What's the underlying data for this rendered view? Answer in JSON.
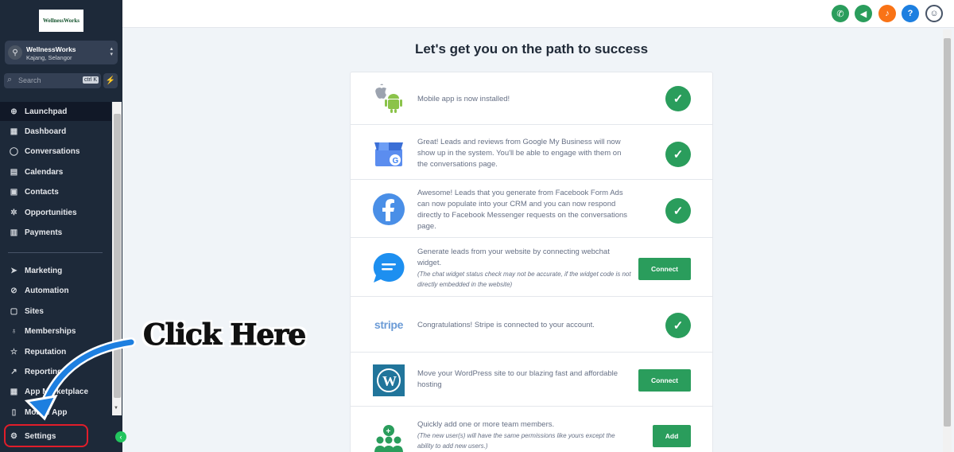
{
  "sidebar": {
    "logo_text": "WellnessWorks",
    "account": {
      "name": "WellnessWorks",
      "location": "Kajang, Selangor"
    },
    "search": {
      "placeholder": "Search",
      "shortcut": "ctrl K"
    },
    "items_top": [
      {
        "label": "Launchpad",
        "icon": "rocket-icon",
        "active": true
      },
      {
        "label": "Dashboard",
        "icon": "grid-icon"
      },
      {
        "label": "Conversations",
        "icon": "chat-icon"
      },
      {
        "label": "Calendars",
        "icon": "calendar-icon"
      },
      {
        "label": "Contacts",
        "icon": "contacts-icon"
      },
      {
        "label": "Opportunities",
        "icon": "network-icon"
      },
      {
        "label": "Payments",
        "icon": "receipt-icon"
      }
    ],
    "items_bottom": [
      {
        "label": "Marketing",
        "icon": "send-icon"
      },
      {
        "label": "Automation",
        "icon": "automation-icon"
      },
      {
        "label": "Sites",
        "icon": "globe-icon"
      },
      {
        "label": "Memberships",
        "icon": "badge-icon"
      },
      {
        "label": "Reputation",
        "icon": "star-icon"
      },
      {
        "label": "Reporting",
        "icon": "trend-icon"
      },
      {
        "label": "App Marketplace",
        "icon": "apps-icon"
      },
      {
        "label": "Mobile App",
        "icon": "phone-icon"
      }
    ],
    "settings_label": "Settings"
  },
  "header": {
    "buttons": [
      {
        "name": "phone-icon",
        "color": "#2a9d5c"
      },
      {
        "name": "megaphone-icon",
        "color": "#2a9d5c"
      },
      {
        "name": "bell-icon",
        "color": "#f97316"
      },
      {
        "name": "help-icon",
        "color": "#1d7fe0"
      },
      {
        "name": "avatar",
        "color": "#ffffff"
      }
    ]
  },
  "main": {
    "title": "Let's get you on the path to success",
    "rows": [
      {
        "icon": "apple-android-icon",
        "text": "Mobile app is now installed!",
        "action": "check"
      },
      {
        "icon": "google-my-business-icon",
        "text": "Great! Leads and reviews from Google My Business will now show up in the system. You'll be able to engage with them on the conversations page.",
        "action": "check"
      },
      {
        "icon": "facebook-icon",
        "text": "Awesome! Leads that you generate from Facebook Form Ads can now populate into your CRM and you can now respond directly to Facebook Messenger requests on the conversations page.",
        "action": "check"
      },
      {
        "icon": "webchat-icon",
        "text": "Generate leads from your website by connecting webchat widget.",
        "note": "(The chat widget status check may not be accurate, if the widget code is not directly embedded in the website)",
        "action": "button",
        "button_label": "Connect"
      },
      {
        "icon": "stripe-logo",
        "logo_text": "stripe",
        "text": "Congratulations! Stripe is connected to your account.",
        "action": "check"
      },
      {
        "icon": "wordpress-icon",
        "text": "Move your WordPress site to our blazing fast and affordable hosting",
        "action": "button",
        "button_label": "Connect"
      },
      {
        "icon": "team-icon",
        "text": "Quickly add one or more team members.",
        "note": "(The new user(s) will have the same permissions like yours except the ability to add new users.)",
        "action": "button",
        "button_label": "Add"
      }
    ]
  },
  "overlay": {
    "callout": "Click Here",
    "highlight_color": "#e11d2a",
    "arrow_color": "#1d7fe0"
  }
}
